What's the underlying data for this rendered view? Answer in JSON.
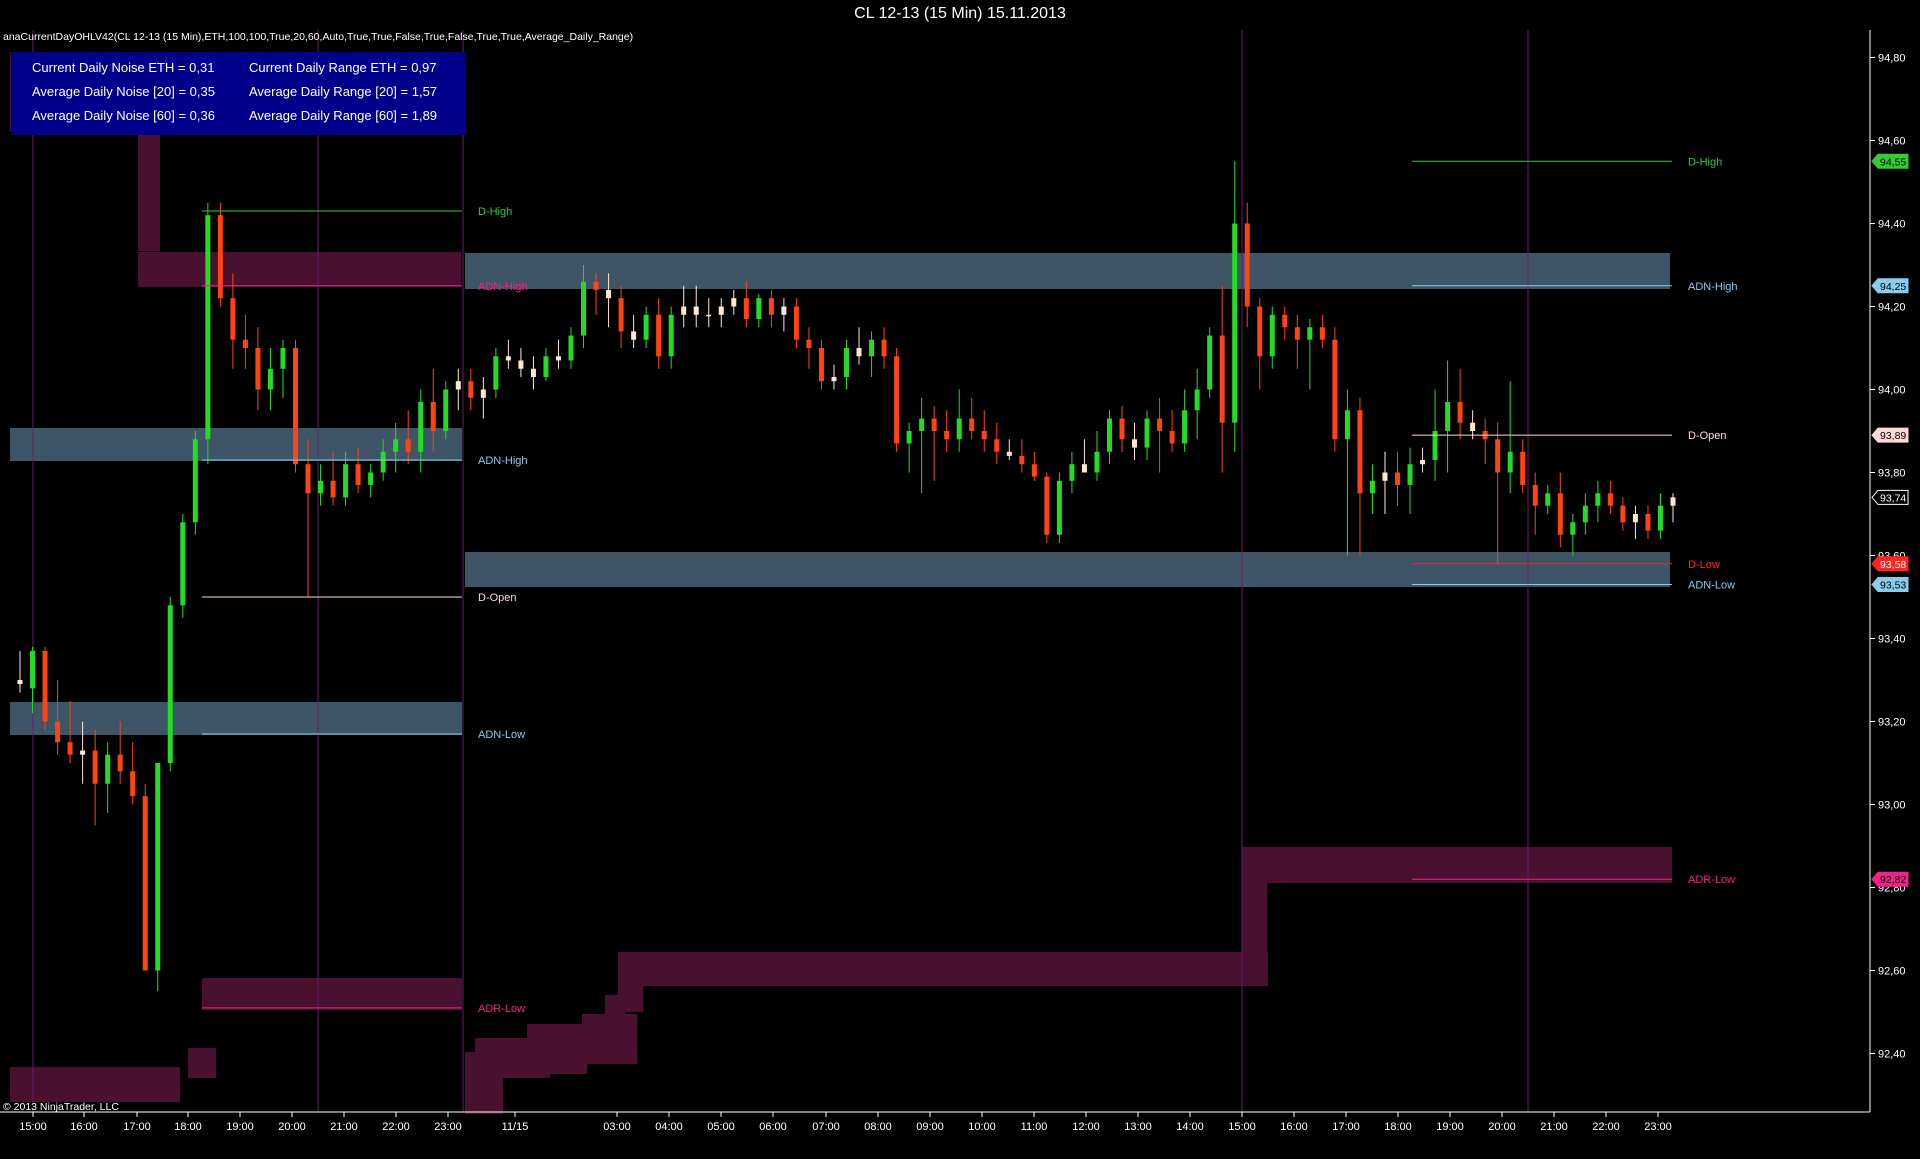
{
  "window_title": "CL 12-13 (15 Min)  15.11.2013",
  "indicator_label": "anaCurrentDayOHLV42(CL 12-13 (15 Min),ETH,100,100,True,20,60,Auto,True,True,False,True,False,True,True,Average_Daily_Range)",
  "copyright": "© 2013 NinjaTrader, LLC",
  "stats": {
    "current_noise": "Current Daily Noise ETH = 0,31",
    "avg_noise_20": "Average Daily Noise [20] = 0,35",
    "avg_noise_60": "Average Daily Noise [60] = 0,36",
    "current_range": "Current Daily Range ETH = 0,97",
    "avg_range_20": "Average Daily Range [20] = 1,57",
    "avg_range_60": "Average Daily Range [60] = 1,89"
  },
  "colors": {
    "background": "#000000",
    "up_candle": "#22dd22",
    "down_candle": "#ff4411",
    "doji_candle": "#ffe8d0",
    "noise_band": "#3d5566",
    "range_band": "#4a1030",
    "session_line": "#6a1a6a",
    "d_high": "#33cc33",
    "d_low": "#ff2222",
    "d_open": "#ffd8d8",
    "adn": "#88ccee",
    "adr": "#ee2288",
    "stats_box": "#00008b"
  },
  "chart_data": {
    "type": "candlestick",
    "symbol": "CL 12-13 (15 Min)",
    "ylim": [
      92.3,
      94.85
    ],
    "y_ticks": [
      "94,80",
      "94,60",
      "94,40",
      "94,20",
      "94,00",
      "93,80",
      "93,60",
      "93,40",
      "93,20",
      "93,00",
      "92,80",
      "92,60",
      "92,40"
    ],
    "x_ticks": [
      "15:00",
      "16:00",
      "17:00",
      "18:00",
      "19:00",
      "20:00",
      "21:00",
      "22:00",
      "23:00",
      "11/15",
      "03:00",
      "04:00",
      "05:00",
      "06:00",
      "07:00",
      "08:00",
      "09:00",
      "10:00",
      "11:00",
      "12:00",
      "13:00",
      "14:00",
      "15:00",
      "16:00",
      "17:00",
      "18:00",
      "19:00",
      "20:00",
      "21:00",
      "22:00",
      "23:00"
    ],
    "price_markers": [
      {
        "label": "94,55",
        "value": 94.55,
        "kind": "d_high"
      },
      {
        "label": "94,25",
        "value": 94.25,
        "kind": "adn"
      },
      {
        "label": "93,89",
        "value": 93.89,
        "kind": "d_open"
      },
      {
        "label": "93,74",
        "value": 93.74,
        "kind": "last"
      },
      {
        "label": "93,58",
        "value": 93.58,
        "kind": "d_low"
      },
      {
        "label": "93,53",
        "value": 93.53,
        "kind": "adn"
      },
      {
        "label": "92,82",
        "value": 92.82,
        "kind": "adr"
      }
    ],
    "sessions": [
      {
        "levels": [
          {
            "name": "D-High",
            "value": 94.43,
            "kind": "d_high"
          },
          {
            "name": "ADN-High",
            "value": 94.25,
            "kind": "adr"
          },
          {
            "name": "ADN-High",
            "value": 93.83,
            "kind": "adn"
          },
          {
            "name": "D-Open",
            "value": 93.5,
            "kind": "d_open"
          },
          {
            "name": "ADN-Low",
            "value": 93.17,
            "kind": "adn"
          },
          {
            "name": "ADR-Low",
            "value": 92.51,
            "kind": "adr"
          }
        ]
      },
      {
        "levels": [
          {
            "name": "D-High",
            "value": 94.55,
            "kind": "d_high"
          },
          {
            "name": "ADN-High",
            "value": 94.25,
            "kind": "adn"
          },
          {
            "name": "D-Open",
            "value": 93.89,
            "kind": "d_open"
          },
          {
            "name": "D-Low",
            "value": 93.58,
            "kind": "d_low"
          },
          {
            "name": "ADN-Low",
            "value": 93.53,
            "kind": "adn"
          },
          {
            "name": "ADR-Low",
            "value": 92.82,
            "kind": "adr"
          }
        ]
      }
    ],
    "candles": [
      [
        93.3,
        93.37,
        93.27,
        93.29
      ],
      [
        93.28,
        93.38,
        93.22,
        93.37
      ],
      [
        93.37,
        93.38,
        93.18,
        93.2
      ],
      [
        93.2,
        93.3,
        93.12,
        93.15
      ],
      [
        93.15,
        93.25,
        93.1,
        93.12
      ],
      [
        93.12,
        93.2,
        93.05,
        93.13
      ],
      [
        93.13,
        93.18,
        92.95,
        93.05
      ],
      [
        93.05,
        93.15,
        92.98,
        93.12
      ],
      [
        93.12,
        93.2,
        93.05,
        93.08
      ],
      [
        93.08,
        93.15,
        93.0,
        93.02
      ],
      [
        93.02,
        93.05,
        92.75,
        92.6
      ],
      [
        92.6,
        93.05,
        92.55,
        93.1
      ],
      [
        93.1,
        93.5,
        93.08,
        93.48
      ],
      [
        93.48,
        93.7,
        93.45,
        93.68
      ],
      [
        93.68,
        93.9,
        93.65,
        93.88
      ],
      [
        93.88,
        94.45,
        93.82,
        94.42
      ],
      [
        94.42,
        94.45,
        94.2,
        94.22
      ],
      [
        94.22,
        94.28,
        94.05,
        94.12
      ],
      [
        94.12,
        94.18,
        94.05,
        94.1
      ],
      [
        94.1,
        94.15,
        93.95,
        94.0
      ],
      [
        94.0,
        94.1,
        93.95,
        94.05
      ],
      [
        94.05,
        94.12,
        93.98,
        94.1
      ],
      [
        94.1,
        94.12,
        93.8,
        93.82
      ],
      [
        93.82,
        93.88,
        93.5,
        93.75
      ],
      [
        93.75,
        93.82,
        93.72,
        93.78
      ],
      [
        93.78,
        93.85,
        93.72,
        93.74
      ],
      [
        93.74,
        93.85,
        93.72,
        93.82
      ],
      [
        93.82,
        93.86,
        93.75,
        93.77
      ],
      [
        93.77,
        93.82,
        93.74,
        93.8
      ],
      [
        93.8,
        93.88,
        93.78,
        93.85
      ],
      [
        93.85,
        93.92,
        93.8,
        93.88
      ],
      [
        93.88,
        93.95,
        93.82,
        93.85
      ],
      [
        93.85,
        94.0,
        93.8,
        93.97
      ],
      [
        93.97,
        94.05,
        93.85,
        93.9
      ],
      [
        93.9,
        94.02,
        93.88,
        94.0
      ],
      [
        94.0,
        94.05,
        93.95,
        94.02
      ],
      [
        94.02,
        94.05,
        93.95,
        93.98
      ],
      [
        93.98,
        94.03,
        93.93,
        94.0
      ],
      [
        94.0,
        94.1,
        93.98,
        94.08
      ],
      [
        94.08,
        94.12,
        94.05,
        94.07
      ],
      [
        94.07,
        94.1,
        94.03,
        94.05
      ],
      [
        94.05,
        94.08,
        94.0,
        94.03
      ],
      [
        94.03,
        94.1,
        94.02,
        94.08
      ],
      [
        94.08,
        94.12,
        94.05,
        94.07
      ],
      [
        94.07,
        94.15,
        94.05,
        94.13
      ],
      [
        94.13,
        94.3,
        94.1,
        94.26
      ],
      [
        94.26,
        94.28,
        94.18,
        94.24
      ],
      [
        94.24,
        94.28,
        94.15,
        94.22
      ],
      [
        94.22,
        94.25,
        94.1,
        94.14
      ],
      [
        94.14,
        94.18,
        94.1,
        94.12
      ],
      [
        94.12,
        94.2,
        94.1,
        94.18
      ],
      [
        94.18,
        94.22,
        94.05,
        94.08
      ],
      [
        94.08,
        94.2,
        94.05,
        94.18
      ],
      [
        94.18,
        94.25,
        94.15,
        94.2
      ],
      [
        94.2,
        94.25,
        94.15,
        94.18
      ],
      [
        94.18,
        94.22,
        94.15,
        94.18
      ],
      [
        94.18,
        94.22,
        94.15,
        94.2
      ],
      [
        94.2,
        94.24,
        94.18,
        94.22
      ],
      [
        94.22,
        94.26,
        94.15,
        94.17
      ],
      [
        94.17,
        94.23,
        94.15,
        94.22
      ],
      [
        94.22,
        94.24,
        94.15,
        94.18
      ],
      [
        94.18,
        94.22,
        94.14,
        94.2
      ],
      [
        94.2,
        94.22,
        94.1,
        94.12
      ],
      [
        94.12,
        94.15,
        94.05,
        94.1
      ],
      [
        94.1,
        94.12,
        94.0,
        94.02
      ],
      [
        94.02,
        94.06,
        94.0,
        94.03
      ],
      [
        94.03,
        94.12,
        94.0,
        94.1
      ],
      [
        94.1,
        94.15,
        94.06,
        94.08
      ],
      [
        94.08,
        94.14,
        94.03,
        94.12
      ],
      [
        94.12,
        94.15,
        94.05,
        94.08
      ],
      [
        94.08,
        94.1,
        93.85,
        93.87
      ],
      [
        93.87,
        93.92,
        93.8,
        93.9
      ],
      [
        93.9,
        93.98,
        93.75,
        93.93
      ],
      [
        93.93,
        93.96,
        93.78,
        93.9
      ],
      [
        93.9,
        93.95,
        93.85,
        93.88
      ],
      [
        93.88,
        94.0,
        93.85,
        93.93
      ],
      [
        93.93,
        93.98,
        93.88,
        93.9
      ],
      [
        93.9,
        93.95,
        93.85,
        93.88
      ],
      [
        93.88,
        93.92,
        93.82,
        93.85
      ],
      [
        93.85,
        93.88,
        93.83,
        93.84
      ],
      [
        93.84,
        93.88,
        93.8,
        93.82
      ],
      [
        93.82,
        93.85,
        93.78,
        93.79
      ],
      [
        93.79,
        93.8,
        93.63,
        93.65
      ],
      [
        93.65,
        93.8,
        93.63,
        93.78
      ],
      [
        93.78,
        93.85,
        93.75,
        93.82
      ],
      [
        93.82,
        93.88,
        93.8,
        93.8
      ],
      [
        93.8,
        93.9,
        93.78,
        93.85
      ],
      [
        93.85,
        93.95,
        93.82,
        93.93
      ],
      [
        93.93,
        93.96,
        93.85,
        93.88
      ],
      [
        93.88,
        93.92,
        93.83,
        93.86
      ],
      [
        93.86,
        93.95,
        93.83,
        93.93
      ],
      [
        93.93,
        93.98,
        93.8,
        93.9
      ],
      [
        93.9,
        93.95,
        93.85,
        93.87
      ],
      [
        93.87,
        94.0,
        93.85,
        93.95
      ],
      [
        93.95,
        94.05,
        93.88,
        94.0
      ],
      [
        94.0,
        94.15,
        93.98,
        94.13
      ],
      [
        94.13,
        94.25,
        93.8,
        93.92
      ],
      [
        93.92,
        94.55,
        93.85,
        94.4
      ],
      [
        94.4,
        94.45,
        94.15,
        94.2
      ],
      [
        94.2,
        94.22,
        94.0,
        94.08
      ],
      [
        94.08,
        94.2,
        94.05,
        94.18
      ],
      [
        94.18,
        94.2,
        94.12,
        94.15
      ],
      [
        94.15,
        94.18,
        94.05,
        94.12
      ],
      [
        94.12,
        94.17,
        94.0,
        94.15
      ],
      [
        94.15,
        94.18,
        94.1,
        94.12
      ],
      [
        94.12,
        94.15,
        93.85,
        93.88
      ],
      [
        93.88,
        94.0,
        93.6,
        93.95
      ],
      [
        93.95,
        93.98,
        93.6,
        93.75
      ],
      [
        93.75,
        93.82,
        93.7,
        93.78
      ],
      [
        93.78,
        93.85,
        93.7,
        93.8
      ],
      [
        93.8,
        93.85,
        93.72,
        93.77
      ],
      [
        93.77,
        93.86,
        93.7,
        93.82
      ],
      [
        93.82,
        93.86,
        93.8,
        93.83
      ],
      [
        93.83,
        94.0,
        93.78,
        93.9
      ],
      [
        93.9,
        94.07,
        93.8,
        93.97
      ],
      [
        93.97,
        94.05,
        93.88,
        93.92
      ],
      [
        93.92,
        93.95,
        93.88,
        93.9
      ],
      [
        93.9,
        93.93,
        93.82,
        93.88
      ],
      [
        93.88,
        93.92,
        93.58,
        93.8
      ],
      [
        93.8,
        94.02,
        93.75,
        93.85
      ],
      [
        93.85,
        93.88,
        93.75,
        93.77
      ],
      [
        93.77,
        93.8,
        93.65,
        93.72
      ],
      [
        93.72,
        93.77,
        93.7,
        93.75
      ],
      [
        93.75,
        93.8,
        93.62,
        93.65
      ],
      [
        93.65,
        93.7,
        93.6,
        93.68
      ],
      [
        93.68,
        93.75,
        93.65,
        93.72
      ],
      [
        93.72,
        93.78,
        93.68,
        93.75
      ],
      [
        93.75,
        93.78,
        93.7,
        93.72
      ],
      [
        93.72,
        93.74,
        93.66,
        93.68
      ],
      [
        93.68,
        93.72,
        93.64,
        93.7
      ],
      [
        93.7,
        93.72,
        93.64,
        93.66
      ],
      [
        93.66,
        93.75,
        93.64,
        93.72
      ],
      [
        93.72,
        93.75,
        93.68,
        93.74
      ]
    ]
  }
}
